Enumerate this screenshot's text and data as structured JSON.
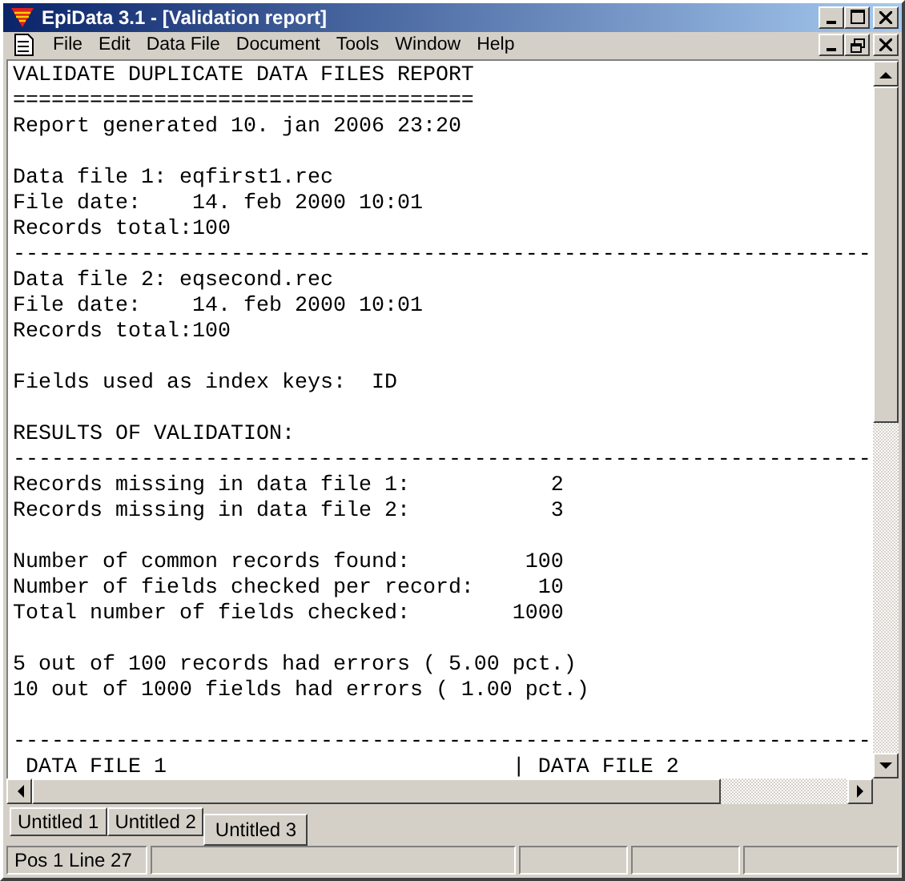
{
  "window": {
    "title": "EpiData 3.1 - [Validation report]"
  },
  "menu": [
    "File",
    "Edit",
    "Data File",
    "Document",
    "Tools",
    "Window",
    "Help"
  ],
  "report": [
    [
      "VALIDATE DUPLICATE DATA FILES REPORT",
      "====================================",
      "Report generated 10. jan 2006 23:20"
    ],
    [
      "Data file 1: eqfirst1.rec",
      "File date:    14. feb 2000 10:01",
      "Records total:100",
      "-------------------------------------------------------------------",
      "Data file 2: eqsecond.rec",
      "File date:    14. feb 2000 10:01",
      "Records total:100"
    ],
    [
      "Fields used as index keys:  ID"
    ],
    [
      "RESULTS OF VALIDATION:",
      "-------------------------------------------------------------------",
      "Records missing in data file 1:           2",
      "Records missing in data file 2:           3"
    ],
    [
      "Number of common records found:         100",
      "Number of fields checked per record:     10",
      "Total number of fields checked:        1000"
    ],
    [
      "5 out of 100 records had errors ( 5.00 pct.)",
      "10 out of 1000 fields had errors ( 1.00 pct.)"
    ],
    [
      "-------------------------------------------------------------------",
      " DATA FILE 1                           | DATA FILE 2"
    ]
  ],
  "tabs": [
    {
      "label": "Untitled 1",
      "selected": false
    },
    {
      "label": "Untitled 2",
      "selected": false
    },
    {
      "label": "Untitled 3",
      "selected": true
    }
  ],
  "status_bar": {
    "position": "Pos 1  Line 27"
  }
}
